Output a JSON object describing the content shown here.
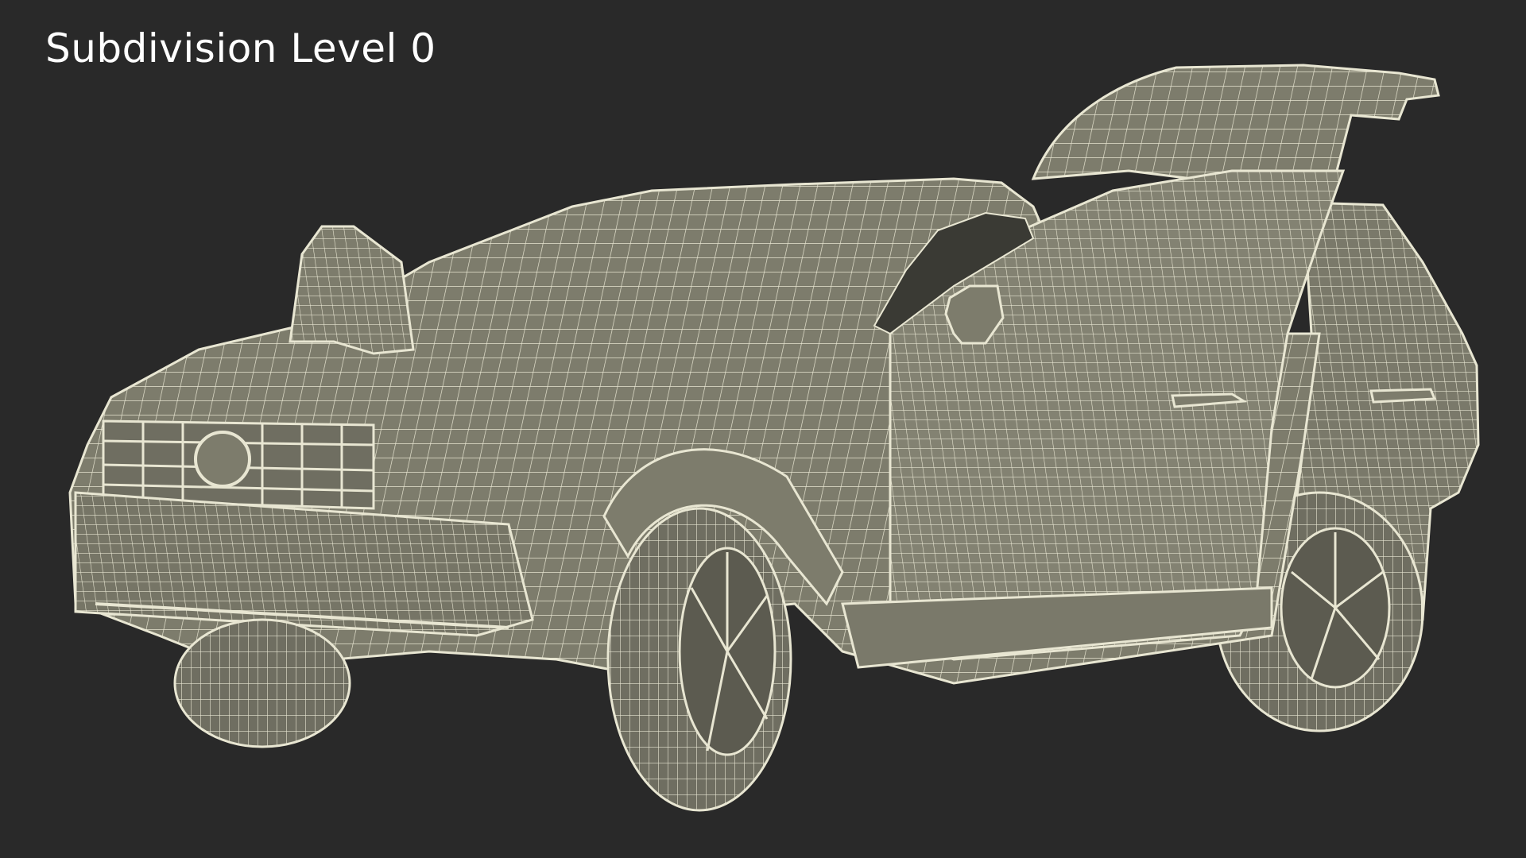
{
  "caption": {
    "text": "Subdivision Level 0"
  },
  "render": {
    "subject": "car-3d-wireframe-model",
    "colors": {
      "background": "#292929",
      "body_fill": "#7d7c6c",
      "body_shade": "#5e5d52",
      "wire": "#e8e6d2",
      "interior": "#3a3a34"
    }
  }
}
